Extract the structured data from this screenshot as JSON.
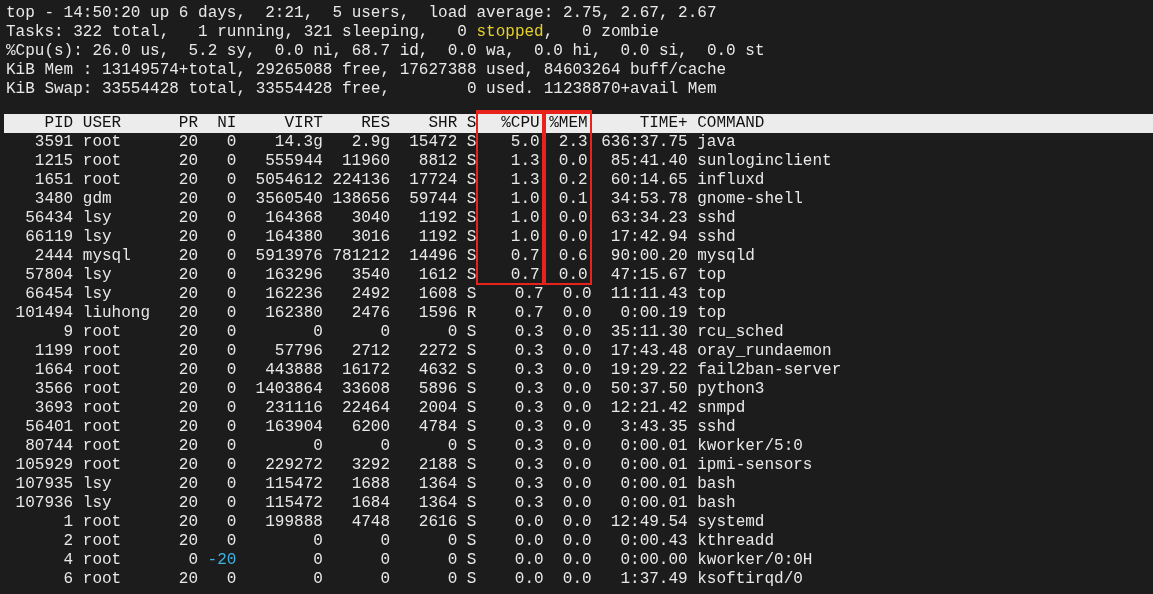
{
  "summary": [
    {
      "segments": [
        {
          "text": "top - 14:50:20 up 6 days,  2:21,  5 users,  load average: 2.75, 2.67, 2.67",
          "highlighted": false
        }
      ]
    },
    {
      "segments": [
        {
          "text": "Tasks: 322 total,   1 running, 321 sleeping,   0 ",
          "highlighted": false
        },
        {
          "text": "stopped",
          "highlighted": true
        },
        {
          "text": ",   0 zombie",
          "highlighted": false
        }
      ]
    },
    {
      "segments": [
        {
          "text": "%Cpu(s): 26.0 us,  5.2 sy,  0.0 ni, 68.7 id,  0.0 wa,  0.0 hi,  0.0 si,  0.0 st",
          "highlighted": false
        }
      ]
    },
    {
      "segments": [
        {
          "text": "KiB Mem : 13149574+total, 29265088 free, 17627388 used, 84603264 buff/cache",
          "highlighted": false
        }
      ]
    },
    {
      "segments": [
        {
          "text": "KiB Swap: 33554428 total, 33554428 free,        0 used. 11238870+avail Mem",
          "highlighted": false
        }
      ]
    }
  ],
  "table": {
    "columns": [
      {
        "label": "PID",
        "boxed": false
      },
      {
        "label": "USER",
        "boxed": false
      },
      {
        "label": "PR",
        "boxed": false
      },
      {
        "label": "NI",
        "boxed": false
      },
      {
        "label": "VIRT",
        "boxed": false
      },
      {
        "label": "RES",
        "boxed": false
      },
      {
        "label": "SHR",
        "boxed": false
      },
      {
        "label": "S",
        "boxed": false
      },
      {
        "label": "%CPU",
        "boxed": true
      },
      {
        "label": "%MEM",
        "boxed": true
      },
      {
        "label": "TIME+",
        "boxed": false
      },
      {
        "label": "COMMAND",
        "boxed": false
      }
    ],
    "rows": [
      {
        "cells": [
          "3591",
          "root",
          "20",
          "0",
          "14.3g",
          "2.9g",
          "15472",
          "S",
          "5.0",
          "2.3",
          "636:37.75",
          "java"
        ],
        "boxed": true,
        "ni_highlighted": false
      },
      {
        "cells": [
          "1215",
          "root",
          "20",
          "0",
          "555944",
          "11960",
          "8812",
          "S",
          "1.3",
          "0.0",
          "85:41.40",
          "sunloginclient"
        ],
        "boxed": true,
        "ni_highlighted": false
      },
      {
        "cells": [
          "1651",
          "root",
          "20",
          "0",
          "5054612",
          "224136",
          "17724",
          "S",
          "1.3",
          "0.2",
          "60:14.65",
          "influxd"
        ],
        "boxed": true,
        "ni_highlighted": false
      },
      {
        "cells": [
          "3480",
          "gdm",
          "20",
          "0",
          "3560540",
          "138656",
          "59744",
          "S",
          "1.0",
          "0.1",
          "34:53.78",
          "gnome-shell"
        ],
        "boxed": true,
        "ni_highlighted": false
      },
      {
        "cells": [
          "56434",
          "lsy",
          "20",
          "0",
          "164368",
          "3040",
          "1192",
          "S",
          "1.0",
          "0.0",
          "63:34.23",
          "sshd"
        ],
        "boxed": true,
        "ni_highlighted": false
      },
      {
        "cells": [
          "66119",
          "lsy",
          "20",
          "0",
          "164380",
          "3016",
          "1192",
          "S",
          "1.0",
          "0.0",
          "17:42.94",
          "sshd"
        ],
        "boxed": true,
        "ni_highlighted": false
      },
      {
        "cells": [
          "2444",
          "mysql",
          "20",
          "0",
          "5913976",
          "781212",
          "14496",
          "S",
          "0.7",
          "0.6",
          "90:00.20",
          "mysqld"
        ],
        "boxed": true,
        "ni_highlighted": false
      },
      {
        "cells": [
          "57804",
          "lsy",
          "20",
          "0",
          "163296",
          "3540",
          "1612",
          "S",
          "0.7",
          "0.0",
          "47:15.67",
          "top"
        ],
        "boxed": true,
        "ni_highlighted": false
      },
      {
        "cells": [
          "66454",
          "lsy",
          "20",
          "0",
          "162236",
          "2492",
          "1608",
          "S",
          "0.7",
          "0.0",
          "11:11.43",
          "top"
        ],
        "boxed": false,
        "ni_highlighted": false
      },
      {
        "cells": [
          "101494",
          "liuhong",
          "20",
          "0",
          "162380",
          "2476",
          "1596",
          "R",
          "0.7",
          "0.0",
          "0:00.19",
          "top"
        ],
        "boxed": false,
        "ni_highlighted": false
      },
      {
        "cells": [
          "9",
          "root",
          "20",
          "0",
          "0",
          "0",
          "0",
          "S",
          "0.3",
          "0.0",
          "35:11.30",
          "rcu_sched"
        ],
        "boxed": false,
        "ni_highlighted": false
      },
      {
        "cells": [
          "1199",
          "root",
          "20",
          "0",
          "57796",
          "2712",
          "2272",
          "S",
          "0.3",
          "0.0",
          "17:43.48",
          "oray_rundaemon"
        ],
        "boxed": false,
        "ni_highlighted": false
      },
      {
        "cells": [
          "1664",
          "root",
          "20",
          "0",
          "443888",
          "16172",
          "4632",
          "S",
          "0.3",
          "0.0",
          "19:29.22",
          "fail2ban-server"
        ],
        "boxed": false,
        "ni_highlighted": false
      },
      {
        "cells": [
          "3566",
          "root",
          "20",
          "0",
          "1403864",
          "33608",
          "5896",
          "S",
          "0.3",
          "0.0",
          "50:37.50",
          "python3"
        ],
        "boxed": false,
        "ni_highlighted": false
      },
      {
        "cells": [
          "3693",
          "root",
          "20",
          "0",
          "231116",
          "22464",
          "2004",
          "S",
          "0.3",
          "0.0",
          "12:21.42",
          "snmpd"
        ],
        "boxed": false,
        "ni_highlighted": false
      },
      {
        "cells": [
          "56401",
          "root",
          "20",
          "0",
          "163904",
          "6200",
          "4784",
          "S",
          "0.3",
          "0.0",
          "3:43.35",
          "sshd"
        ],
        "boxed": false,
        "ni_highlighted": false
      },
      {
        "cells": [
          "80744",
          "root",
          "20",
          "0",
          "0",
          "0",
          "0",
          "S",
          "0.3",
          "0.0",
          "0:00.01",
          "kworker/5:0"
        ],
        "boxed": false,
        "ni_highlighted": false
      },
      {
        "cells": [
          "105929",
          "root",
          "20",
          "0",
          "229272",
          "3292",
          "2188",
          "S",
          "0.3",
          "0.0",
          "0:00.01",
          "ipmi-sensors"
        ],
        "boxed": false,
        "ni_highlighted": false
      },
      {
        "cells": [
          "107935",
          "lsy",
          "20",
          "0",
          "115472",
          "1688",
          "1364",
          "S",
          "0.3",
          "0.0",
          "0:00.01",
          "bash"
        ],
        "boxed": false,
        "ni_highlighted": false
      },
      {
        "cells": [
          "107936",
          "lsy",
          "20",
          "0",
          "115472",
          "1684",
          "1364",
          "S",
          "0.3",
          "0.0",
          "0:00.01",
          "bash"
        ],
        "boxed": false,
        "ni_highlighted": false
      },
      {
        "cells": [
          "1",
          "root",
          "20",
          "0",
          "199888",
          "4748",
          "2616",
          "S",
          "0.0",
          "0.0",
          "12:49.54",
          "systemd"
        ],
        "boxed": false,
        "ni_highlighted": false
      },
      {
        "cells": [
          "2",
          "root",
          "20",
          "0",
          "0",
          "0",
          "0",
          "S",
          "0.0",
          "0.0",
          "0:00.43",
          "kthreadd"
        ],
        "boxed": false,
        "ni_highlighted": false
      },
      {
        "cells": [
          "4",
          "root",
          "0",
          "-20",
          "0",
          "0",
          "0",
          "S",
          "0.0",
          "0.0",
          "0:00.00",
          "kworker/0:0H"
        ],
        "boxed": false,
        "ni_highlighted": true
      },
      {
        "cells": [
          "6",
          "root",
          "20",
          "0",
          "0",
          "0",
          "0",
          "S",
          "0.0",
          "0.0",
          "1:37.49",
          "ksoftirqd/0"
        ],
        "boxed": false,
        "ni_highlighted": false
      }
    ]
  }
}
